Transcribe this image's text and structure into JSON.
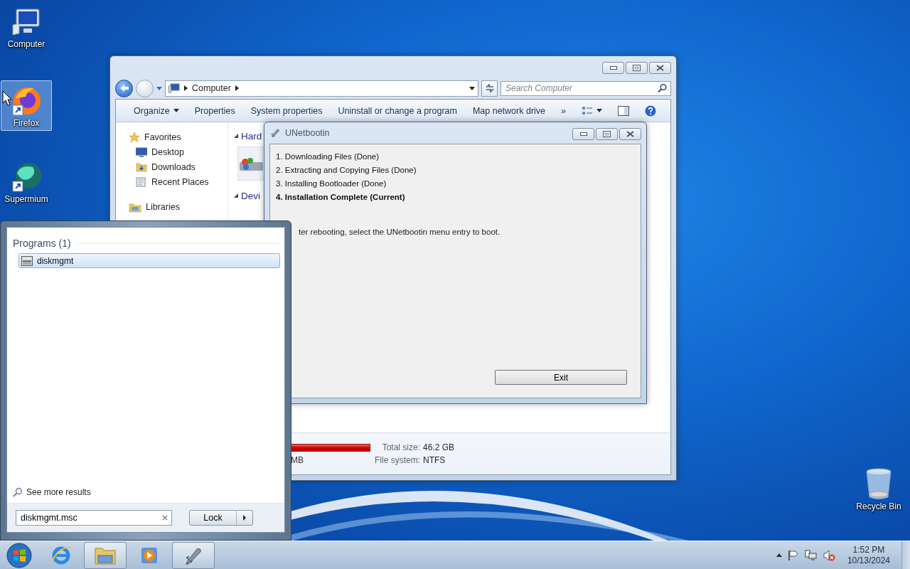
{
  "desktop_icons": [
    {
      "label": "Computer",
      "kind": "computer",
      "selected": false
    },
    {
      "label": "Firefox",
      "kind": "firefox",
      "selected": true
    },
    {
      "label": "Supermium",
      "kind": "supermium",
      "selected": false
    },
    {
      "label": "Recycle Bin",
      "kind": "recycle",
      "selected": false
    }
  ],
  "explorer": {
    "breadcrumb": [
      "Computer"
    ],
    "search": {
      "placeholder": "Search Computer"
    },
    "toolbar": [
      {
        "label": "Organize",
        "dropdown": true
      },
      {
        "label": "Properties",
        "dropdown": false
      },
      {
        "label": "System properties",
        "dropdown": false
      },
      {
        "label": "Uninstall or change a program",
        "dropdown": false
      },
      {
        "label": "Map network drive",
        "dropdown": false
      }
    ],
    "overflow": "»",
    "nav": [
      {
        "label": "Favorites",
        "kind": "star",
        "children": [
          {
            "label": "Desktop",
            "kind": "desktop"
          },
          {
            "label": "Downloads",
            "kind": "downloads"
          },
          {
            "label": "Recent Places",
            "kind": "recent"
          }
        ]
      },
      {
        "label": "Libraries",
        "kind": "library"
      }
    ],
    "sections": [
      "Hard",
      "Devi"
    ],
    "details": [
      {
        "label": "Total size:",
        "value": "46.2 GB"
      },
      {
        "left": "MB",
        "label": "File system:",
        "value": "NTFS"
      }
    ]
  },
  "unetbootin": {
    "title": "UNetbootin",
    "steps": [
      {
        "text": "1. Downloading Files (Done)",
        "current": false
      },
      {
        "text": "2. Extracting and Copying Files (Done)",
        "current": false
      },
      {
        "text": "3. Installing Bootloader (Done)",
        "current": false
      },
      {
        "text": "4. Installation Complete (Current)",
        "current": true
      }
    ],
    "message": "ter rebooting, select the UNetbootin menu entry to boot.",
    "button": "Exit"
  },
  "start_menu": {
    "group": "Programs (1)",
    "results": [
      {
        "label": "diskmgmt",
        "selected": true
      }
    ],
    "more": "See more results",
    "search": {
      "value": "diskmgmt.msc"
    },
    "power_button": "Lock"
  },
  "taskbar": {
    "items": [
      {
        "kind": "ie",
        "active": false
      },
      {
        "kind": "explorer",
        "active": true
      },
      {
        "kind": "media",
        "active": false
      },
      {
        "kind": "unetbootin",
        "active": true
      }
    ],
    "clock": {
      "time": "1:52 PM",
      "date": "10/13/2024"
    }
  }
}
